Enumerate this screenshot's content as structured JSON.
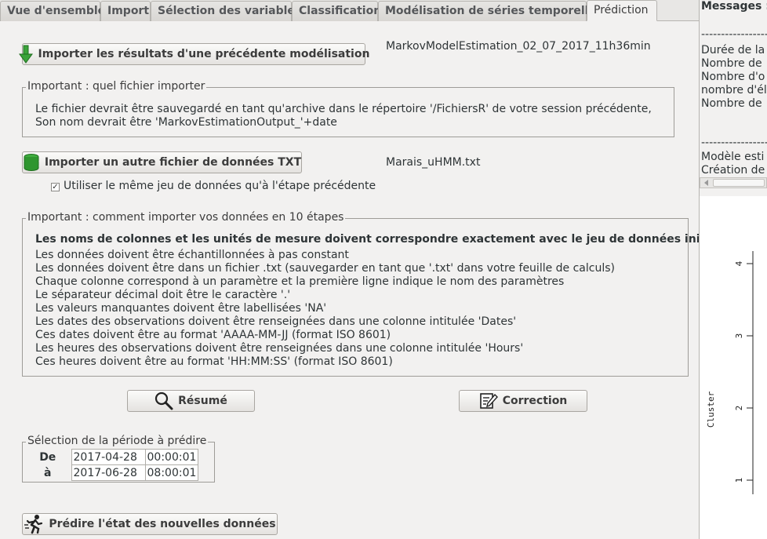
{
  "tabs": [
    {
      "label": "Vue d'ensemble"
    },
    {
      "label": "Import"
    },
    {
      "label": "Sélection des variables"
    },
    {
      "label": "Classification"
    },
    {
      "label": "Modélisation de séries temporelles"
    },
    {
      "label": "Prédiction"
    }
  ],
  "import_results": {
    "button_label": "Importer les résultats d'une précédente modélisation",
    "filename": "MarkovModelEstimation_02_07_2017_11h36min",
    "group_title": "Important : quel fichier importer",
    "lines": [
      "Le fichier devrait être sauvegardé en tant qu'archive dans le répertoire '/FichiersR' de votre session précédente,",
      "Son nom devrait être 'MarkovEstimationOutput_'+date"
    ]
  },
  "import_data": {
    "button_label": "Importer un autre fichier de données TXT",
    "filename": "Marais_uHMM.txt",
    "checkbox_label": "Utiliser le même jeu de données qu'à l'étape précédente",
    "checkbox_checked": true
  },
  "instructions": {
    "group_title": "Important : comment importer vos données en 10 étapes",
    "heading": "Les noms de colonnes et les unités de mesure doivent correspondre exactement avec le jeu de données initial",
    "lines": [
      "Les données doivent être échantillonnées à pas constant",
      "Les données doivent être dans un fichier .txt (sauvegarder en tant que '.txt' dans votre feuille de calculs)",
      "Chaque colonne correspond à un paramètre et la première ligne indique le nom des paramètres",
      "Le séparateur décimal doit être le caractère '.'",
      "Les valeurs manquantes doivent être labellisées 'NA'",
      "Les dates des observations doivent être renseignées dans une colonne intitulée 'Dates'",
      "Ces dates doivent être au format 'AAAA-MM-JJ (format ISO 8601)",
      "Les heures des observations doivent être renseignées dans une colonne intitulée 'Hours'",
      "Ces heures doivent être au format 'HH:MM:SS' (format ISO 8601)"
    ]
  },
  "actions": {
    "summary_label": "Résumé",
    "correction_label": "Correction",
    "predict_label": "Prédire l'état des nouvelles données"
  },
  "period": {
    "group_title": "Sélection de la période à prédire",
    "from_label": "De",
    "to_label": "à",
    "from_date": "2017-04-28",
    "from_time": "00:00:01",
    "to_date": "2017-06-28",
    "to_time": "08:00:01"
  },
  "messages": {
    "header": "Messages :",
    "lines_block1": [
      "Durée de la",
      "Nombre de",
      "Nombre d'o",
      "nombre d'él",
      "Nombre de"
    ],
    "lines_block2": [
      "Modèle esti",
      "Création de"
    ]
  },
  "plot": {
    "ylabel": "Cluster",
    "yticks": [
      "4",
      "3",
      "2",
      "1"
    ]
  },
  "icons": {
    "import_results": "green-down-arrow-icon",
    "import_data": "green-database-icon",
    "summary": "magnifier-icon",
    "correction": "edit-notepad-icon",
    "predict": "running-man-icon"
  }
}
